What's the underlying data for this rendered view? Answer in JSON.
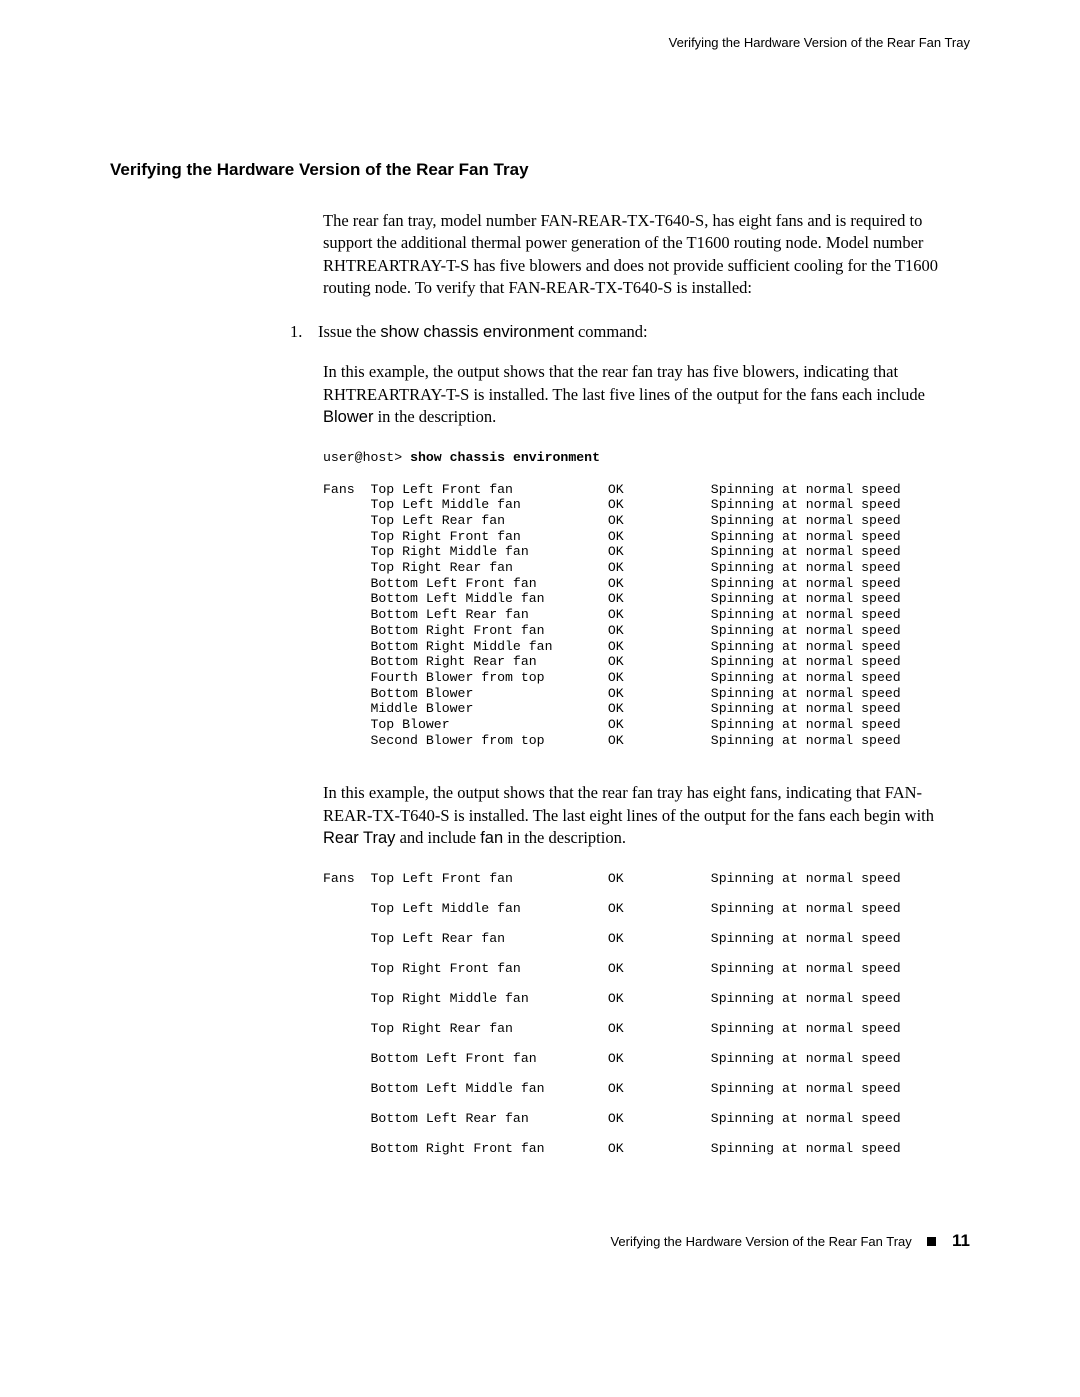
{
  "running_head": "Verifying the Hardware Version of the Rear Fan Tray",
  "section_title": "Verifying the Hardware Version of the Rear Fan Tray",
  "intro": "The rear fan tray, model number FAN-REAR-TX-T640-S, has eight fans and is required to support the additional thermal power generation of the T1600 routing node. Model number RHTREARTRAY-T-S has five blowers and does not provide sufficient cooling for the T1600 routing node. To verify that FAN-REAR-TX-T640-S is installed:",
  "step1_num": "1.",
  "step1_prefix": "Issue the ",
  "step1_cmd": "show chassis environment",
  "step1_suffix": " command:",
  "example1_p_a": "In this example, the output shows that the rear fan tray has five blowers, indicating that RHTREARTRAY-T-S is installed. The last five lines of the output for the fans each include ",
  "example1_p_bold": "Blower",
  "example1_p_b": " in the description.",
  "terminal1_prompt": "user@host> ",
  "terminal1_cmd": "show chassis environment",
  "terminal1_group_label": "Fans",
  "terminal1_rows": [
    {
      "name": "Top Left Front fan",
      "status": "OK",
      "info": "Spinning at normal speed"
    },
    {
      "name": "Top Left Middle fan",
      "status": "OK",
      "info": "Spinning at normal speed"
    },
    {
      "name": "Top Left Rear fan",
      "status": "OK",
      "info": "Spinning at normal speed"
    },
    {
      "name": "Top Right Front fan",
      "status": "OK",
      "info": "Spinning at normal speed"
    },
    {
      "name": "Top Right Middle fan",
      "status": "OK",
      "info": "Spinning at normal speed"
    },
    {
      "name": "Top Right Rear fan",
      "status": "OK",
      "info": "Spinning at normal speed"
    },
    {
      "name": "Bottom Left Front fan",
      "status": "OK",
      "info": "Spinning at normal speed"
    },
    {
      "name": "Bottom Left Middle fan",
      "status": "OK",
      "info": "Spinning at normal speed"
    },
    {
      "name": "Bottom Left Rear fan",
      "status": "OK",
      "info": "Spinning at normal speed"
    },
    {
      "name": "Bottom Right Front fan",
      "status": "OK",
      "info": "Spinning at normal speed"
    },
    {
      "name": "Bottom Right Middle fan",
      "status": "OK",
      "info": "Spinning at normal speed"
    },
    {
      "name": "Bottom Right Rear fan",
      "status": "OK",
      "info": "Spinning at normal speed"
    },
    {
      "name": "Fourth Blower from top",
      "status": "OK",
      "info": "Spinning at normal speed"
    },
    {
      "name": "Bottom Blower",
      "status": "OK",
      "info": "Spinning at normal speed"
    },
    {
      "name": "Middle Blower",
      "status": "OK",
      "info": "Spinning at normal speed"
    },
    {
      "name": "Top Blower",
      "status": "OK",
      "info": "Spinning at normal speed"
    },
    {
      "name": "Second Blower from top",
      "status": "OK",
      "info": "Spinning at normal speed"
    }
  ],
  "example2_p_a": "In this example, the output shows that the rear fan tray has eight fans, indicating that FAN-REAR-TX-T640-S is installed. The last eight lines of the output for the fans each begin with ",
  "example2_p_bold1": "Rear Tray",
  "example2_p_mid": " and include ",
  "example2_p_bold2": "fan",
  "example2_p_b": " in the description.",
  "terminal2_group_label": "Fans",
  "terminal2_rows": [
    {
      "name": "Top Left Front fan",
      "status": "OK",
      "info": "Spinning at normal speed"
    },
    {
      "name": "Top Left Middle fan",
      "status": "OK",
      "info": "Spinning at normal speed"
    },
    {
      "name": "Top Left Rear fan",
      "status": "OK",
      "info": "Spinning at normal speed"
    },
    {
      "name": "Top Right Front fan",
      "status": "OK",
      "info": "Spinning at normal speed"
    },
    {
      "name": "Top Right Middle fan",
      "status": "OK",
      "info": "Spinning at normal speed"
    },
    {
      "name": "Top Right Rear fan",
      "status": "OK",
      "info": "Spinning at normal speed"
    },
    {
      "name": "Bottom Left Front fan",
      "status": "OK",
      "info": "Spinning at normal speed"
    },
    {
      "name": "Bottom Left Middle fan",
      "status": "OK",
      "info": "Spinning at normal speed"
    },
    {
      "name": "Bottom Left Rear fan",
      "status": "OK",
      "info": "Spinning at normal speed"
    },
    {
      "name": "Bottom Right Front fan",
      "status": "OK",
      "info": "Spinning at normal speed"
    }
  ],
  "footer_text": "Verifying the Hardware Version of the Rear Fan Tray",
  "page_number": "11"
}
